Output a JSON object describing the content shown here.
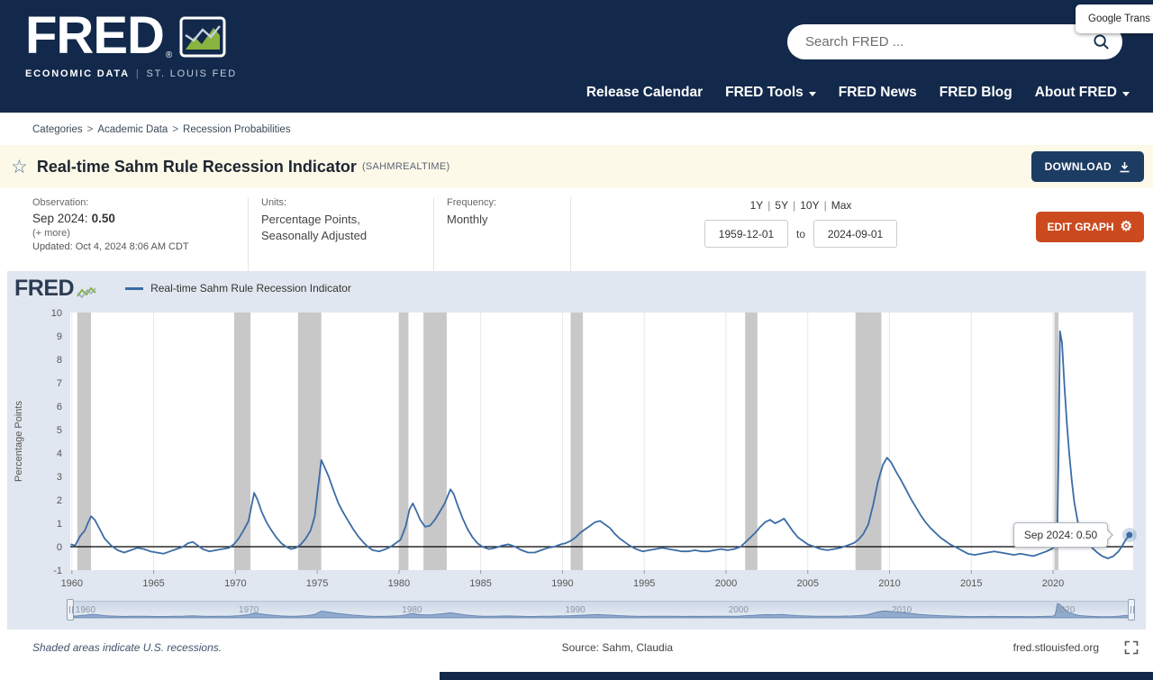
{
  "header": {
    "logo": "FRED",
    "registered": "®",
    "tagline_left": "ECONOMIC DATA",
    "tagline_sep": "|",
    "tagline_right": "ST. LOUIS FED",
    "search_placeholder": "Search FRED ...",
    "nav": [
      {
        "label": "Release Calendar",
        "dropdown": false
      },
      {
        "label": "FRED Tools",
        "dropdown": true
      },
      {
        "label": "FRED News",
        "dropdown": false
      },
      {
        "label": "FRED Blog",
        "dropdown": false
      },
      {
        "label": "About FRED",
        "dropdown": true
      }
    ],
    "translate_label": "Google Trans"
  },
  "breadcrumb": {
    "items": [
      "Categories",
      "Academic Data",
      "Recession Probabilities"
    ],
    "separator": ">"
  },
  "title_bar": {
    "title": "Real-time Sahm Rule Recession Indicator",
    "series_id": "(SAHMREALTIME)",
    "download_label": "DOWNLOAD"
  },
  "meta": {
    "observation_label": "Observation:",
    "observation_date": "Sep 2024:",
    "observation_value": "0.50",
    "more_label": "(+ more)",
    "updated": "Updated: Oct 4, 2024 8:06 AM CDT",
    "units_label": "Units:",
    "units_line1": "Percentage Points,",
    "units_line2": "Seasonally Adjusted",
    "frequency_label": "Frequency:",
    "frequency": "Monthly",
    "ranges": [
      "1Y",
      "5Y",
      "10Y",
      "Max"
    ],
    "range_sep": "|",
    "date_start": "1959-12-01",
    "date_to_label": "to",
    "date_end": "2024-09-01",
    "edit_graph_label": "EDIT GRAPH"
  },
  "chart": {
    "watermark": "FRED",
    "legend_label": "Real-time Sahm Rule Recession Indicator",
    "tooltip": "Sep 2024: 0.50",
    "footnote": "Shaded areas indicate U.S. recessions.",
    "source": "Source: Sahm, Claudia",
    "site": "fred.stlouisfed.org"
  },
  "chart_data": {
    "type": "line",
    "title": "Real-time Sahm Rule Recession Indicator",
    "ylabel": "Percentage Points",
    "xlabel": "",
    "xlim": [
      1959.9,
      2024.9
    ],
    "ylim": [
      -1,
      10
    ],
    "yticks": [
      -1,
      0,
      1,
      2,
      3,
      4,
      5,
      6,
      7,
      8,
      9,
      10
    ],
    "xticks": [
      1960,
      1965,
      1970,
      1975,
      1980,
      1985,
      1990,
      1995,
      2000,
      2005,
      2010,
      2015,
      2020
    ],
    "slider_years": [
      1960,
      1970,
      1980,
      1990,
      2000,
      2010,
      2020
    ],
    "line_color": "#3a6ca5",
    "recession_color": "#c8c8c8",
    "grid_color": "#e8e8e8",
    "zero_line_color": "#000000",
    "mini_fill": "#91abcf",
    "mini_stroke": "#6787b3",
    "legend_position": "top",
    "recessions": [
      [
        1960.33,
        1961.17
      ],
      [
        1969.92,
        1970.92
      ],
      [
        1973.83,
        1975.25
      ],
      [
        1980.0,
        1980.58
      ],
      [
        1981.5,
        1982.92
      ],
      [
        1990.5,
        1991.25
      ],
      [
        2001.17,
        2001.92
      ],
      [
        2007.92,
        2009.5
      ],
      [
        2020.08,
        2020.33
      ]
    ],
    "points": [
      [
        1959.92,
        0.1
      ],
      [
        1960.2,
        0.05
      ],
      [
        1960.5,
        0.45
      ],
      [
        1960.8,
        0.7
      ],
      [
        1961.0,
        1.05
      ],
      [
        1961.17,
        1.3
      ],
      [
        1961.4,
        1.15
      ],
      [
        1961.7,
        0.75
      ],
      [
        1962.0,
        0.35
      ],
      [
        1962.4,
        0.05
      ],
      [
        1962.8,
        -0.15
      ],
      [
        1963.2,
        -0.25
      ],
      [
        1963.6,
        -0.15
      ],
      [
        1964.0,
        -0.05
      ],
      [
        1964.4,
        -0.1
      ],
      [
        1964.8,
        -0.2
      ],
      [
        1965.2,
        -0.25
      ],
      [
        1965.6,
        -0.3
      ],
      [
        1966.0,
        -0.2
      ],
      [
        1966.4,
        -0.1
      ],
      [
        1966.8,
        0.0
      ],
      [
        1967.1,
        0.15
      ],
      [
        1967.4,
        0.2
      ],
      [
        1967.7,
        0.05
      ],
      [
        1968.0,
        -0.1
      ],
      [
        1968.4,
        -0.2
      ],
      [
        1968.8,
        -0.15
      ],
      [
        1969.2,
        -0.1
      ],
      [
        1969.6,
        -0.05
      ],
      [
        1969.9,
        0.1
      ],
      [
        1970.2,
        0.35
      ],
      [
        1970.5,
        0.7
      ],
      [
        1970.8,
        1.1
      ],
      [
        1971.0,
        1.8
      ],
      [
        1971.15,
        2.3
      ],
      [
        1971.35,
        2.0
      ],
      [
        1971.6,
        1.5
      ],
      [
        1971.9,
        1.05
      ],
      [
        1972.2,
        0.7
      ],
      [
        1972.5,
        0.4
      ],
      [
        1972.8,
        0.15
      ],
      [
        1973.1,
        0.0
      ],
      [
        1973.4,
        -0.1
      ],
      [
        1973.7,
        -0.05
      ],
      [
        1974.0,
        0.1
      ],
      [
        1974.3,
        0.35
      ],
      [
        1974.6,
        0.7
      ],
      [
        1974.85,
        1.3
      ],
      [
        1975.05,
        2.5
      ],
      [
        1975.25,
        3.7
      ],
      [
        1975.45,
        3.4
      ],
      [
        1975.7,
        3.0
      ],
      [
        1976.0,
        2.4
      ],
      [
        1976.3,
        1.85
      ],
      [
        1976.6,
        1.45
      ],
      [
        1976.9,
        1.1
      ],
      [
        1977.2,
        0.75
      ],
      [
        1977.5,
        0.45
      ],
      [
        1977.8,
        0.2
      ],
      [
        1978.1,
        0.0
      ],
      [
        1978.4,
        -0.15
      ],
      [
        1978.8,
        -0.2
      ],
      [
        1979.2,
        -0.1
      ],
      [
        1979.5,
        0.0
      ],
      [
        1979.8,
        0.15
      ],
      [
        1980.1,
        0.3
      ],
      [
        1980.4,
        0.85
      ],
      [
        1980.65,
        1.6
      ],
      [
        1980.85,
        1.85
      ],
      [
        1981.05,
        1.55
      ],
      [
        1981.3,
        1.15
      ],
      [
        1981.6,
        0.85
      ],
      [
        1981.9,
        0.9
      ],
      [
        1982.2,
        1.15
      ],
      [
        1982.5,
        1.5
      ],
      [
        1982.8,
        1.85
      ],
      [
        1983.0,
        2.2
      ],
      [
        1983.15,
        2.45
      ],
      [
        1983.35,
        2.25
      ],
      [
        1983.6,
        1.75
      ],
      [
        1983.9,
        1.2
      ],
      [
        1984.2,
        0.75
      ],
      [
        1984.5,
        0.4
      ],
      [
        1984.8,
        0.15
      ],
      [
        1985.1,
        0.0
      ],
      [
        1985.5,
        -0.1
      ],
      [
        1985.9,
        -0.05
      ],
      [
        1986.3,
        0.05
      ],
      [
        1986.7,
        0.1
      ],
      [
        1987.1,
        0.0
      ],
      [
        1987.5,
        -0.15
      ],
      [
        1987.9,
        -0.25
      ],
      [
        1988.3,
        -0.25
      ],
      [
        1988.7,
        -0.15
      ],
      [
        1989.1,
        -0.05
      ],
      [
        1989.5,
        0.0
      ],
      [
        1989.9,
        0.1
      ],
      [
        1990.2,
        0.15
      ],
      [
        1990.5,
        0.25
      ],
      [
        1990.8,
        0.4
      ],
      [
        1991.1,
        0.6
      ],
      [
        1991.4,
        0.75
      ],
      [
        1991.7,
        0.9
      ],
      [
        1992.0,
        1.05
      ],
      [
        1992.3,
        1.1
      ],
      [
        1992.6,
        0.95
      ],
      [
        1992.9,
        0.8
      ],
      [
        1993.2,
        0.55
      ],
      [
        1993.5,
        0.35
      ],
      [
        1993.8,
        0.2
      ],
      [
        1994.1,
        0.05
      ],
      [
        1994.5,
        -0.1
      ],
      [
        1994.9,
        -0.2
      ],
      [
        1995.3,
        -0.15
      ],
      [
        1995.7,
        -0.1
      ],
      [
        1996.1,
        -0.05
      ],
      [
        1996.5,
        -0.1
      ],
      [
        1996.9,
        -0.15
      ],
      [
        1997.3,
        -0.2
      ],
      [
        1997.7,
        -0.2
      ],
      [
        1998.1,
        -0.15
      ],
      [
        1998.5,
        -0.2
      ],
      [
        1998.9,
        -0.2
      ],
      [
        1999.3,
        -0.15
      ],
      [
        1999.7,
        -0.1
      ],
      [
        2000.1,
        -0.15
      ],
      [
        2000.5,
        -0.1
      ],
      [
        2000.9,
        0.0
      ],
      [
        2001.2,
        0.2
      ],
      [
        2001.5,
        0.4
      ],
      [
        2001.8,
        0.6
      ],
      [
        2002.1,
        0.85
      ],
      [
        2002.4,
        1.05
      ],
      [
        2002.7,
        1.15
      ],
      [
        2003.0,
        1.0
      ],
      [
        2003.3,
        1.1
      ],
      [
        2003.55,
        1.2
      ],
      [
        2003.8,
        0.95
      ],
      [
        2004.1,
        0.65
      ],
      [
        2004.4,
        0.4
      ],
      [
        2004.7,
        0.25
      ],
      [
        2005.0,
        0.1
      ],
      [
        2005.4,
        0.0
      ],
      [
        2005.8,
        -0.1
      ],
      [
        2006.2,
        -0.15
      ],
      [
        2006.6,
        -0.1
      ],
      [
        2007.0,
        -0.05
      ],
      [
        2007.4,
        0.05
      ],
      [
        2007.8,
        0.15
      ],
      [
        2008.1,
        0.3
      ],
      [
        2008.4,
        0.55
      ],
      [
        2008.7,
        0.95
      ],
      [
        2009.0,
        1.8
      ],
      [
        2009.3,
        2.8
      ],
      [
        2009.6,
        3.5
      ],
      [
        2009.85,
        3.8
      ],
      [
        2010.1,
        3.6
      ],
      [
        2010.4,
        3.2
      ],
      [
        2010.7,
        2.85
      ],
      [
        2011.0,
        2.45
      ],
      [
        2011.3,
        2.05
      ],
      [
        2011.6,
        1.7
      ],
      [
        2011.9,
        1.35
      ],
      [
        2012.2,
        1.05
      ],
      [
        2012.5,
        0.8
      ],
      [
        2012.8,
        0.6
      ],
      [
        2013.1,
        0.4
      ],
      [
        2013.4,
        0.25
      ],
      [
        2013.7,
        0.1
      ],
      [
        2014.0,
        0.0
      ],
      [
        2014.4,
        -0.15
      ],
      [
        2014.8,
        -0.3
      ],
      [
        2015.2,
        -0.35
      ],
      [
        2015.6,
        -0.3
      ],
      [
        2016.0,
        -0.25
      ],
      [
        2016.4,
        -0.2
      ],
      [
        2016.8,
        -0.25
      ],
      [
        2017.2,
        -0.3
      ],
      [
        2017.6,
        -0.35
      ],
      [
        2018.0,
        -0.3
      ],
      [
        2018.4,
        -0.35
      ],
      [
        2018.8,
        -0.4
      ],
      [
        2019.2,
        -0.3
      ],
      [
        2019.6,
        -0.2
      ],
      [
        2019.9,
        -0.1
      ],
      [
        2020.1,
        0.0
      ],
      [
        2020.25,
        0.4
      ],
      [
        2020.35,
        4.5
      ],
      [
        2020.42,
        9.2
      ],
      [
        2020.55,
        8.7
      ],
      [
        2020.7,
        6.8
      ],
      [
        2020.85,
        5.2
      ],
      [
        2021.0,
        3.9
      ],
      [
        2021.15,
        2.8
      ],
      [
        2021.3,
        1.9
      ],
      [
        2021.5,
        1.1
      ],
      [
        2021.7,
        0.6
      ],
      [
        2021.9,
        0.35
      ],
      [
        2022.1,
        0.15
      ],
      [
        2022.4,
        -0.05
      ],
      [
        2022.7,
        -0.25
      ],
      [
        2023.0,
        -0.4
      ],
      [
        2023.35,
        -0.5
      ],
      [
        2023.7,
        -0.4
      ],
      [
        2024.0,
        -0.2
      ],
      [
        2024.2,
        0.0
      ],
      [
        2024.45,
        0.3
      ],
      [
        2024.67,
        0.5
      ]
    ]
  }
}
